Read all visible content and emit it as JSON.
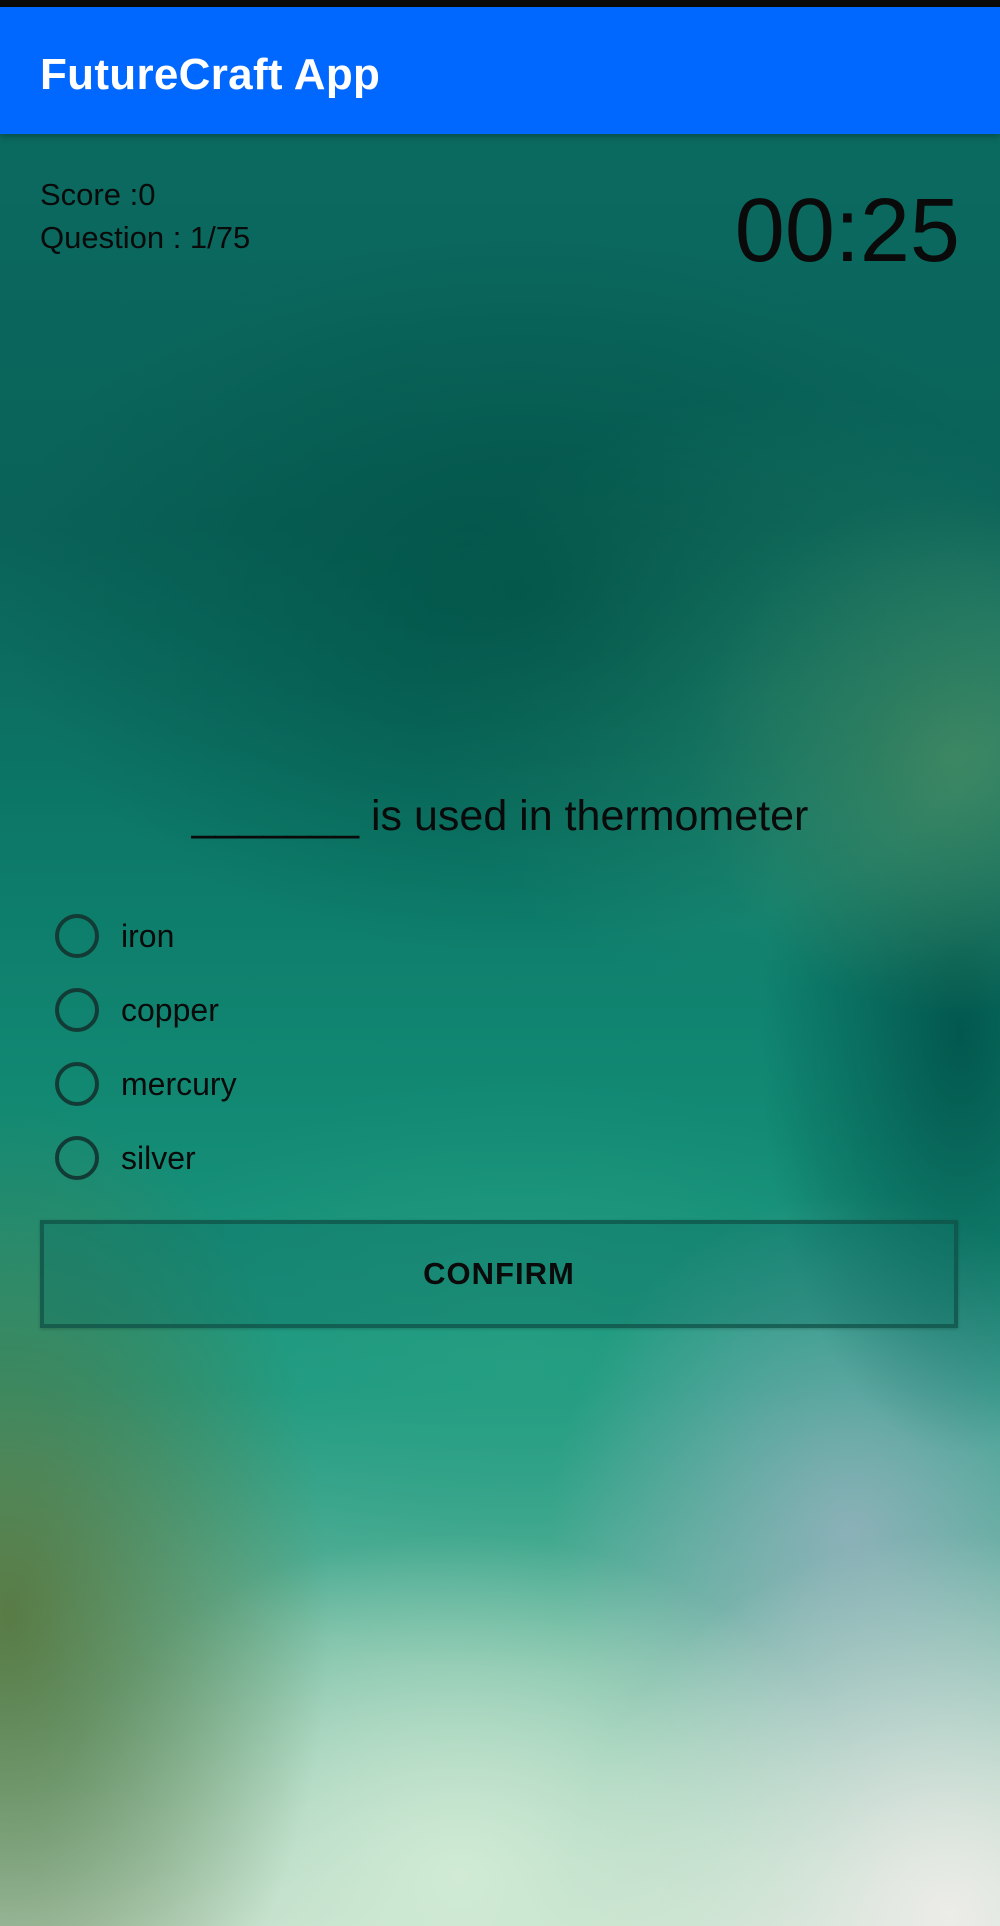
{
  "app_bar": {
    "title": "FutureCraft App",
    "color": "#0068ff"
  },
  "quiz": {
    "score_label": "Score :0",
    "question_counter": "Question : 1/75",
    "timer": "00:25",
    "question": "_______ is used in thermometer",
    "options": [
      {
        "label": "iron",
        "selected": false
      },
      {
        "label": "copper",
        "selected": false
      },
      {
        "label": "mercury",
        "selected": false
      },
      {
        "label": "silver",
        "selected": false
      }
    ],
    "confirm_label": "CONFIRM"
  }
}
